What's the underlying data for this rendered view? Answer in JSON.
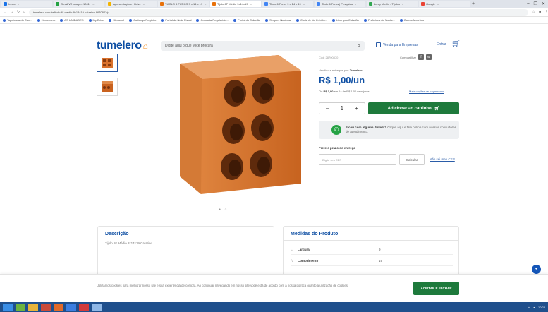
{
  "browser": {
    "tabs": [
      {
        "label": "Inbox",
        "color": "#1a73e8"
      },
      {
        "label": "Gmail Whatsapp (1001)",
        "color": "#25a244"
      },
      {
        "label": "Apresentações - Drive",
        "color": "#f4b400"
      },
      {
        "label": "TIJOLO 6 FUROS 9 x 14 x 19",
        "color": "#e8710a"
      },
      {
        "label": "Tijolo 6F Médio 9x14x19",
        "color": "#e8710a"
      },
      {
        "label": "Tijolo 6 Furos 9 x 14 x 19",
        "color": "#4285f4"
      },
      {
        "label": "Tijolo 6 Furos | Pesquisa",
        "color": "#4285f4"
      },
      {
        "label": "Leroy Merlin - Tijolos",
        "color": "#34a853"
      },
      {
        "label": "Google",
        "color": "#ea4335"
      }
    ],
    "new_tab": "+",
    "window_controls": [
      "–",
      "❐",
      "✕"
    ],
    "url": "tumelero.com.br/tijolo-6f-medio-9x14x19-catarino-8670843/p",
    "bookmarks": [
      "Tapeixaria do Cen...",
      "Home aero",
      "AS UNIDADES",
      "My Drive",
      "Streamel",
      "Catálogo Registro",
      "Portal da Nota Fiscal",
      "Consulta Regularida...",
      "Portal do Cidadão",
      "Simples Nacional",
      "Controle de Crédito...",
      "Licenças Cidadão",
      "Prefeitura de Santa...",
      "Outros favoritos"
    ]
  },
  "site": {
    "logo_text": "tumelero",
    "search_placeholder": "Digite aqui o que você procura",
    "sell_label": "Venda para Empresas",
    "enter_label": "Entrar"
  },
  "product": {
    "code": "Cód: 28700870",
    "share_label": "Compartilhar",
    "seller_prefix": "Vendido e entregue por:",
    "seller_name": "Tumelero",
    "price": "R$ 1,00/un",
    "installment_prefix": "Ou",
    "installment_value": "R$ 1,00",
    "installment_suffix": "em 1x de R$ 1,00 sem juros",
    "payment_options": "Mais opções de pagamento",
    "quantity": "1",
    "qty_minus": "–",
    "qty_plus": "+",
    "add_to_cart": "Adicionar ao carrinho",
    "help_title": "Ficou com alguma dúvida?",
    "help_text": "Clique aqui e fale online com nossos consultores de atendimento.",
    "shipping_label": "Frete e prazo de entrega",
    "cep_placeholder": "Digite seu CEP",
    "calc_button": "Calcular",
    "dont_know_cep": "Não sei meu CEP",
    "gallery_dots": "● ○"
  },
  "description": {
    "title": "Descrição",
    "text": "Tijolo 6F Médio 9x14x19 Catarino"
  },
  "measures": {
    "title": "Medidas do Produto",
    "rows": [
      {
        "label": "Largura",
        "value": "9"
      },
      {
        "label": "Comprimento",
        "value": "19"
      }
    ]
  },
  "cookie": {
    "text": "Utilizamos cookies para melhorar nosso site e sua experiência de compra. Ao continuar navegando em nosso site você está de acordo com a nossa política quanto a utilização de cookies.",
    "button": "ACEITAR E FECHAR"
  },
  "taskbar": {
    "clock": "10:28"
  },
  "colors": {
    "brand_blue": "#0d4ea3",
    "brand_orange": "#f28c1c",
    "cta_green": "#1e7a3c",
    "brick": "#d9722e"
  }
}
